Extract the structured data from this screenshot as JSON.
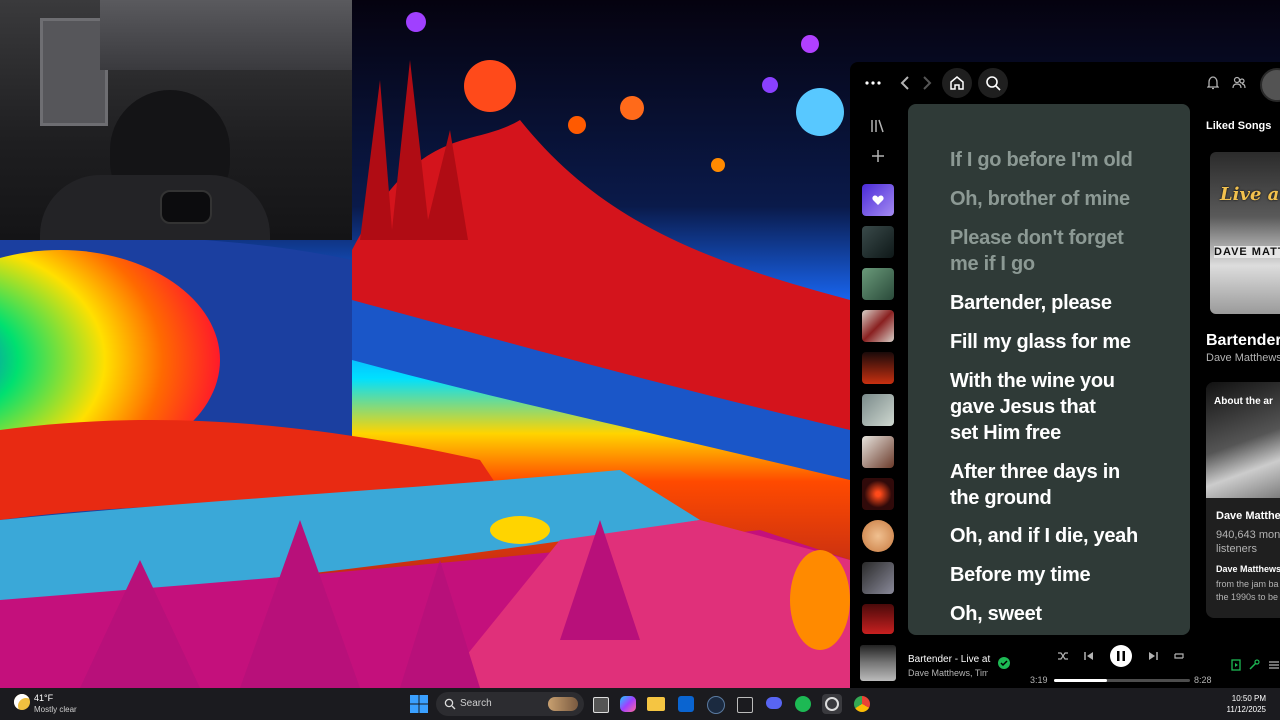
{
  "spotify": {
    "lyrics": [
      {
        "text": "If I go before I'm old",
        "state": "past"
      },
      {
        "text": "Oh, brother of mine",
        "state": "past"
      },
      {
        "text": "Please don't forget me if I go",
        "state": "past"
      },
      {
        "text": "Bartender, please",
        "state": "current"
      },
      {
        "text": "Fill my glass for me",
        "state": "current"
      },
      {
        "text": "With the wine you gave Jesus that set Him free",
        "state": "current"
      },
      {
        "text": "After three days in the ground",
        "state": "current"
      },
      {
        "text": "Oh, and if I die, yeah",
        "state": "current"
      },
      {
        "text": "Before my time",
        "state": "current"
      },
      {
        "text": "Oh, sweet",
        "state": "current"
      }
    ],
    "right_panel": {
      "header": "Liked Songs",
      "song_title": "Bartender",
      "artist": "Dave Matthews",
      "cover_text_1": "Live at",
      "cover_text_2": "DAVE MATT",
      "about_header": "About the ar",
      "about_name": "Dave Matthe",
      "monthly_count": "940,643 mon",
      "monthly_suffix": "listeners",
      "bio_title": "Dave Matthews",
      "bio_lines": [
        "from the jam ba",
        "the 1990s to be"
      ]
    },
    "player": {
      "title": "Bartender - Live at",
      "artists": "Dave Matthews, Tim R",
      "elapsed": "3:19",
      "duration": "8:28",
      "progress": 0.39
    }
  },
  "taskbar": {
    "weather_temp": "41°F",
    "weather_cond": "Mostly clear",
    "search_label": "Search",
    "time": "10:50 PM",
    "date": "11/12/2025"
  },
  "colors": {
    "lyrics_bg": "#2f3a37",
    "lyric_past": "#8c9994",
    "lyric_current": "#ffffff",
    "spotify_green": "#1db954",
    "liked_purple": "#7b4ff0"
  }
}
